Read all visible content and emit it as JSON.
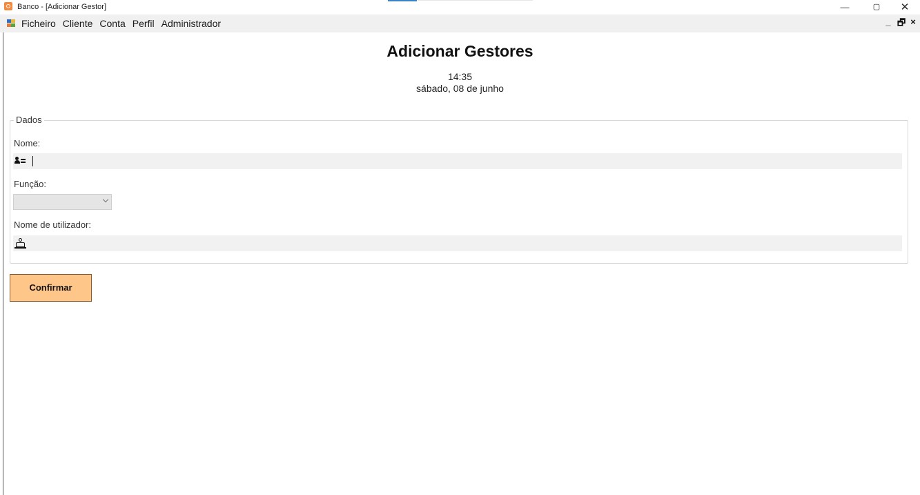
{
  "window": {
    "title": "Banco - [Adicionar Gestor]",
    "controls": {
      "minimize": "—",
      "maximize": "▢",
      "close": "✕"
    }
  },
  "menu": {
    "items": [
      {
        "label": "Ficheiro"
      },
      {
        "label": "Cliente"
      },
      {
        "label": "Conta"
      },
      {
        "label": "Perfil"
      },
      {
        "label": "Administrador"
      }
    ],
    "mdi_controls": {
      "minimize": "_",
      "restore": "🗗",
      "close": "×"
    }
  },
  "page": {
    "title": "Adicionar Gestores",
    "time": "14:35",
    "date": "sábado, 08 de junho"
  },
  "group": {
    "legend": "Dados",
    "fields": {
      "nome": {
        "label": "Nome:",
        "value": "",
        "icon": "user-card-icon"
      },
      "funcao": {
        "label": "Função:",
        "selected": "",
        "icon": "chevron-down-icon"
      },
      "utilizador": {
        "label": "Nome de utilizador:",
        "value": "",
        "icon": "stamp-icon"
      }
    }
  },
  "actions": {
    "confirm_label": "Confirmar"
  },
  "colors": {
    "button_bg": "#ffc68a",
    "button_border": "#8a5a2a",
    "input_bg": "#f1f1f1",
    "menubar_bg": "#f0f0f0",
    "app_icon": "#f58a3c"
  }
}
